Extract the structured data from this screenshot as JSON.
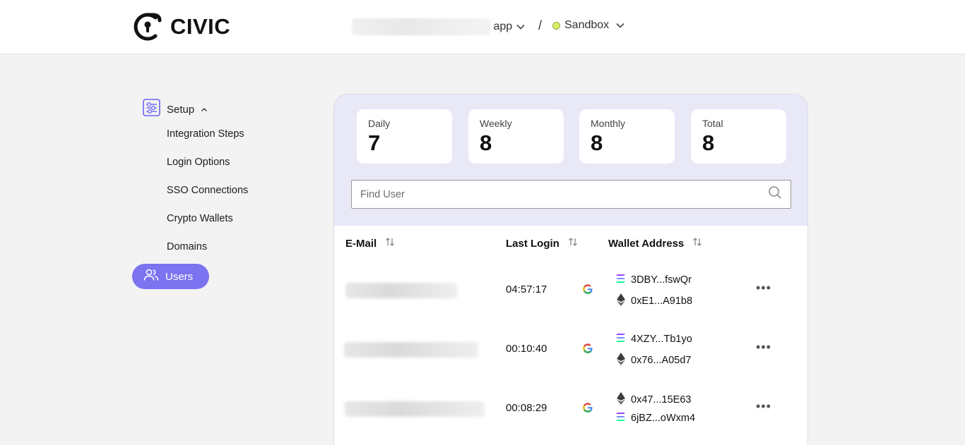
{
  "header": {
    "brand": "CIVIC",
    "app_suffix": "s app",
    "separator": "/",
    "environment": "Sandbox"
  },
  "sidebar": {
    "setup_label": "Setup",
    "items": [
      {
        "label": "Integration Steps"
      },
      {
        "label": "Login Options"
      },
      {
        "label": "SSO Connections"
      },
      {
        "label": "Crypto Wallets"
      },
      {
        "label": "Domains"
      }
    ],
    "active_label": "Users"
  },
  "stats": [
    {
      "label": "Daily",
      "value": "7"
    },
    {
      "label": "Weekly",
      "value": "8"
    },
    {
      "label": "Monthly",
      "value": "8"
    },
    {
      "label": "Total",
      "value": "8"
    }
  ],
  "search": {
    "placeholder": "Find User"
  },
  "table": {
    "columns": [
      "E-Mail",
      "Last Login",
      "Wallet Address"
    ],
    "rows": [
      {
        "last_login": "04:57:17",
        "provider": "google-icon",
        "wallets": [
          {
            "chain": "solana-icon",
            "address": "3DBY...fswQr"
          },
          {
            "chain": "ethereum-icon",
            "address": "0xE1...A91b8"
          }
        ]
      },
      {
        "last_login": "00:10:40",
        "provider": "google-icon",
        "wallets": [
          {
            "chain": "solana-icon",
            "address": "4XZY...Tb1yo"
          },
          {
            "chain": "ethereum-icon",
            "address": "0x76...A05d7"
          }
        ]
      },
      {
        "last_login": "00:08:29",
        "provider": "google-icon",
        "wallets": [
          {
            "chain": "ethereum-icon",
            "address": "0x47...15E63"
          },
          {
            "chain": "solana-icon",
            "address": "6jBZ...oWxm4"
          }
        ]
      }
    ]
  },
  "colors": {
    "accent": "#7b73ef",
    "panel": "#e9e8f7",
    "env_dot": "#d9ee6b"
  }
}
